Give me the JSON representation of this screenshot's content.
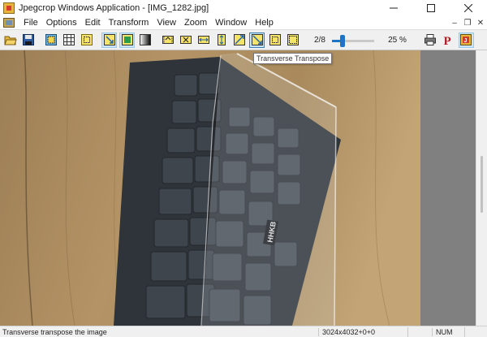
{
  "window": {
    "title": "Jpegcrop Windows Application - [IMG_1282.jpg]",
    "controls": [
      "minimize",
      "maximize",
      "close"
    ]
  },
  "menubar": {
    "items": [
      "File",
      "Options",
      "Edit",
      "Transform",
      "View",
      "Zoom",
      "Window",
      "Help"
    ]
  },
  "toolbar": {
    "buttons": [
      {
        "name": "open-icon"
      },
      {
        "name": "save-icon"
      },
      {
        "name": "select-icon"
      },
      {
        "name": "grid-icon"
      },
      {
        "name": "crop-frame-icon"
      },
      {
        "name": "crop-to-selection-icon"
      },
      {
        "name": "crop-fit-icon"
      },
      {
        "name": "grayscale-icon"
      },
      {
        "name": "rotate-left-icon"
      },
      {
        "name": "rotate-right-icon"
      },
      {
        "name": "flip-horizontal-icon"
      },
      {
        "name": "flip-vertical-icon"
      },
      {
        "name": "transpose-icon"
      },
      {
        "name": "transverse-transpose-icon"
      },
      {
        "name": "trim-left-icon"
      },
      {
        "name": "trim-right-icon"
      },
      {
        "name": "print-icon"
      },
      {
        "name": "properties-icon"
      },
      {
        "name": "about-icon"
      }
    ],
    "page_counter": "2/8",
    "zoom_label": "25 %",
    "zoom_level_percent": 25
  },
  "tooltip": {
    "text": "Transverse Transpose"
  },
  "statusbar": {
    "message": "Transverse transpose the image",
    "dimensions": "3024x4032+0+0",
    "num_lock": "NUM"
  },
  "image": {
    "keycap_logo": "HHKB"
  }
}
